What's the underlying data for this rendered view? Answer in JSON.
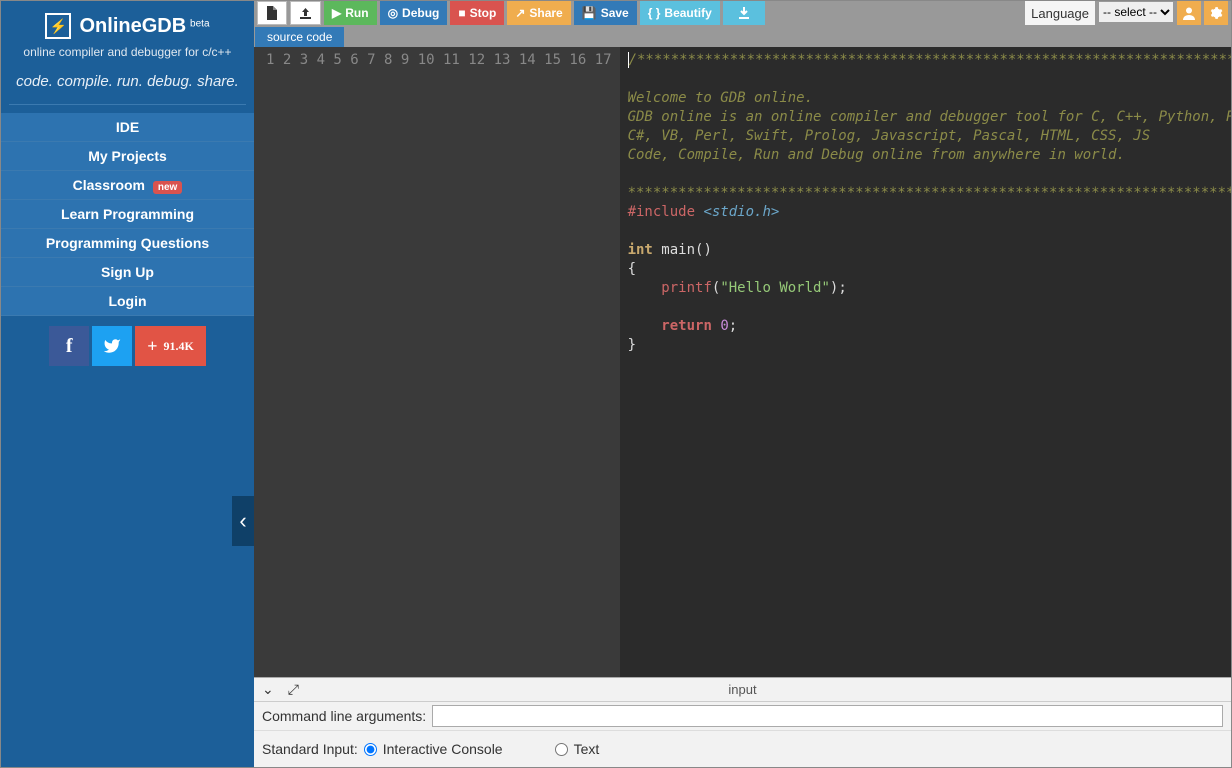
{
  "brand": {
    "name": "OnlineGDB",
    "beta": "beta",
    "sub1": "online compiler and debugger for c/c++",
    "sub2": "code. compile. run. debug. share."
  },
  "nav": {
    "ide": "IDE",
    "projects": "My Projects",
    "classroom": "Classroom",
    "classroom_badge": "new",
    "learn": "Learn Programming",
    "questions": "Programming Questions",
    "signup": "Sign Up",
    "login": "Login"
  },
  "social": {
    "count": "91.4K"
  },
  "toolbar": {
    "run": "Run",
    "debug": "Debug",
    "stop": "Stop",
    "share": "Share",
    "save": "Save",
    "beautify": "Beautify",
    "lang_label": "Language",
    "lang_placeholder": "-- select --"
  },
  "tab": {
    "source": "source code"
  },
  "code": {
    "c1": "/******************************************************************************",
    "c2": "",
    "c3": "Welcome to GDB online.",
    "c4": "GDB online is an online compiler and debugger tool for C, C++, Python, PHP, Ruby, ",
    "c5": "C#, VB, Perl, Swift, Prolog, Javascript, Pascal, HTML, CSS, JS",
    "c6": "Code, Compile, Run and Debug online from anywhere in world.",
    "c7": "",
    "c8": "*******************************************************************************/",
    "inc_kw": "#include ",
    "inc_val": "<stdio.h>",
    "main_type": "int",
    "main_rest": " main()",
    "brace_open": "{",
    "printf": "printf",
    "printf_open": "(",
    "printf_str": "\"Hello World\"",
    "printf_close": ");",
    "return_kw": "return",
    "return_sp": " ",
    "return_num": "0",
    "return_semi": ";",
    "brace_close": "}",
    "indent": "    "
  },
  "io": {
    "title": "input",
    "args_label": "Command line arguments:",
    "stdin_label": "Standard Input:",
    "radio_console": "Interactive Console",
    "radio_text": "Text"
  }
}
